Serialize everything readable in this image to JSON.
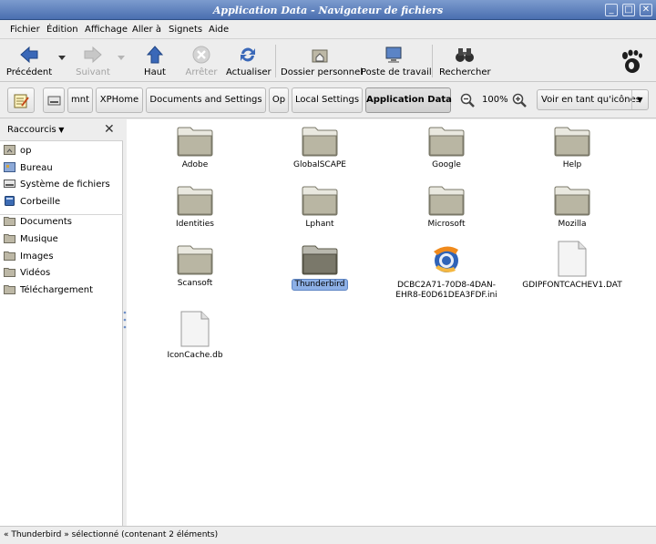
{
  "window": {
    "title": "Application Data - Navigateur de fichiers"
  },
  "menu": [
    "Fichier",
    "Édition",
    "Affichage",
    "Aller à",
    "Signets",
    "Aide"
  ],
  "toolbar": {
    "back": "Précédent",
    "forward": "Suivant",
    "up": "Haut",
    "stop": "Arrêter",
    "reload": "Actualiser",
    "home": "Dossier personnel",
    "computer": "Poste de travail",
    "search": "Rechercher"
  },
  "location": {
    "crumbs": [
      "mnt",
      "XPHome",
      "Documents and Settings",
      "Op",
      "Local Settings",
      "Application Data"
    ],
    "zoom": "100%",
    "view_mode": "Voir en tant qu'icônes"
  },
  "sidebar": {
    "title": "Raccourcis",
    "places": [
      "op",
      "Bureau",
      "Système de fichiers",
      "Corbeille"
    ],
    "bookmarks": [
      "Documents",
      "Musique",
      "Images",
      "Vidéos",
      "Téléchargement"
    ]
  },
  "files": [
    {
      "name": "Adobe",
      "type": "folder"
    },
    {
      "name": "GlobalSCAPE",
      "type": "folder"
    },
    {
      "name": "Google",
      "type": "folder"
    },
    {
      "name": "Help",
      "type": "folder"
    },
    {
      "name": "Identities",
      "type": "folder"
    },
    {
      "name": "Lphant",
      "type": "folder"
    },
    {
      "name": "Microsoft",
      "type": "folder"
    },
    {
      "name": "Mozilla",
      "type": "folder"
    },
    {
      "name": "Scansoft",
      "type": "folder"
    },
    {
      "name": "Thunderbird",
      "type": "folder",
      "selected": true
    },
    {
      "name": "DCBC2A71-70D8-4DAN-EHR8-E0D61DEA3FDF.ini",
      "type": "ini"
    },
    {
      "name": "GDIPFONTCACHEV1.DAT",
      "type": "file"
    },
    {
      "name": "IconCache.db",
      "type": "file"
    }
  ],
  "status": "« Thunderbird » sélectionné (contenant 2 éléments)"
}
